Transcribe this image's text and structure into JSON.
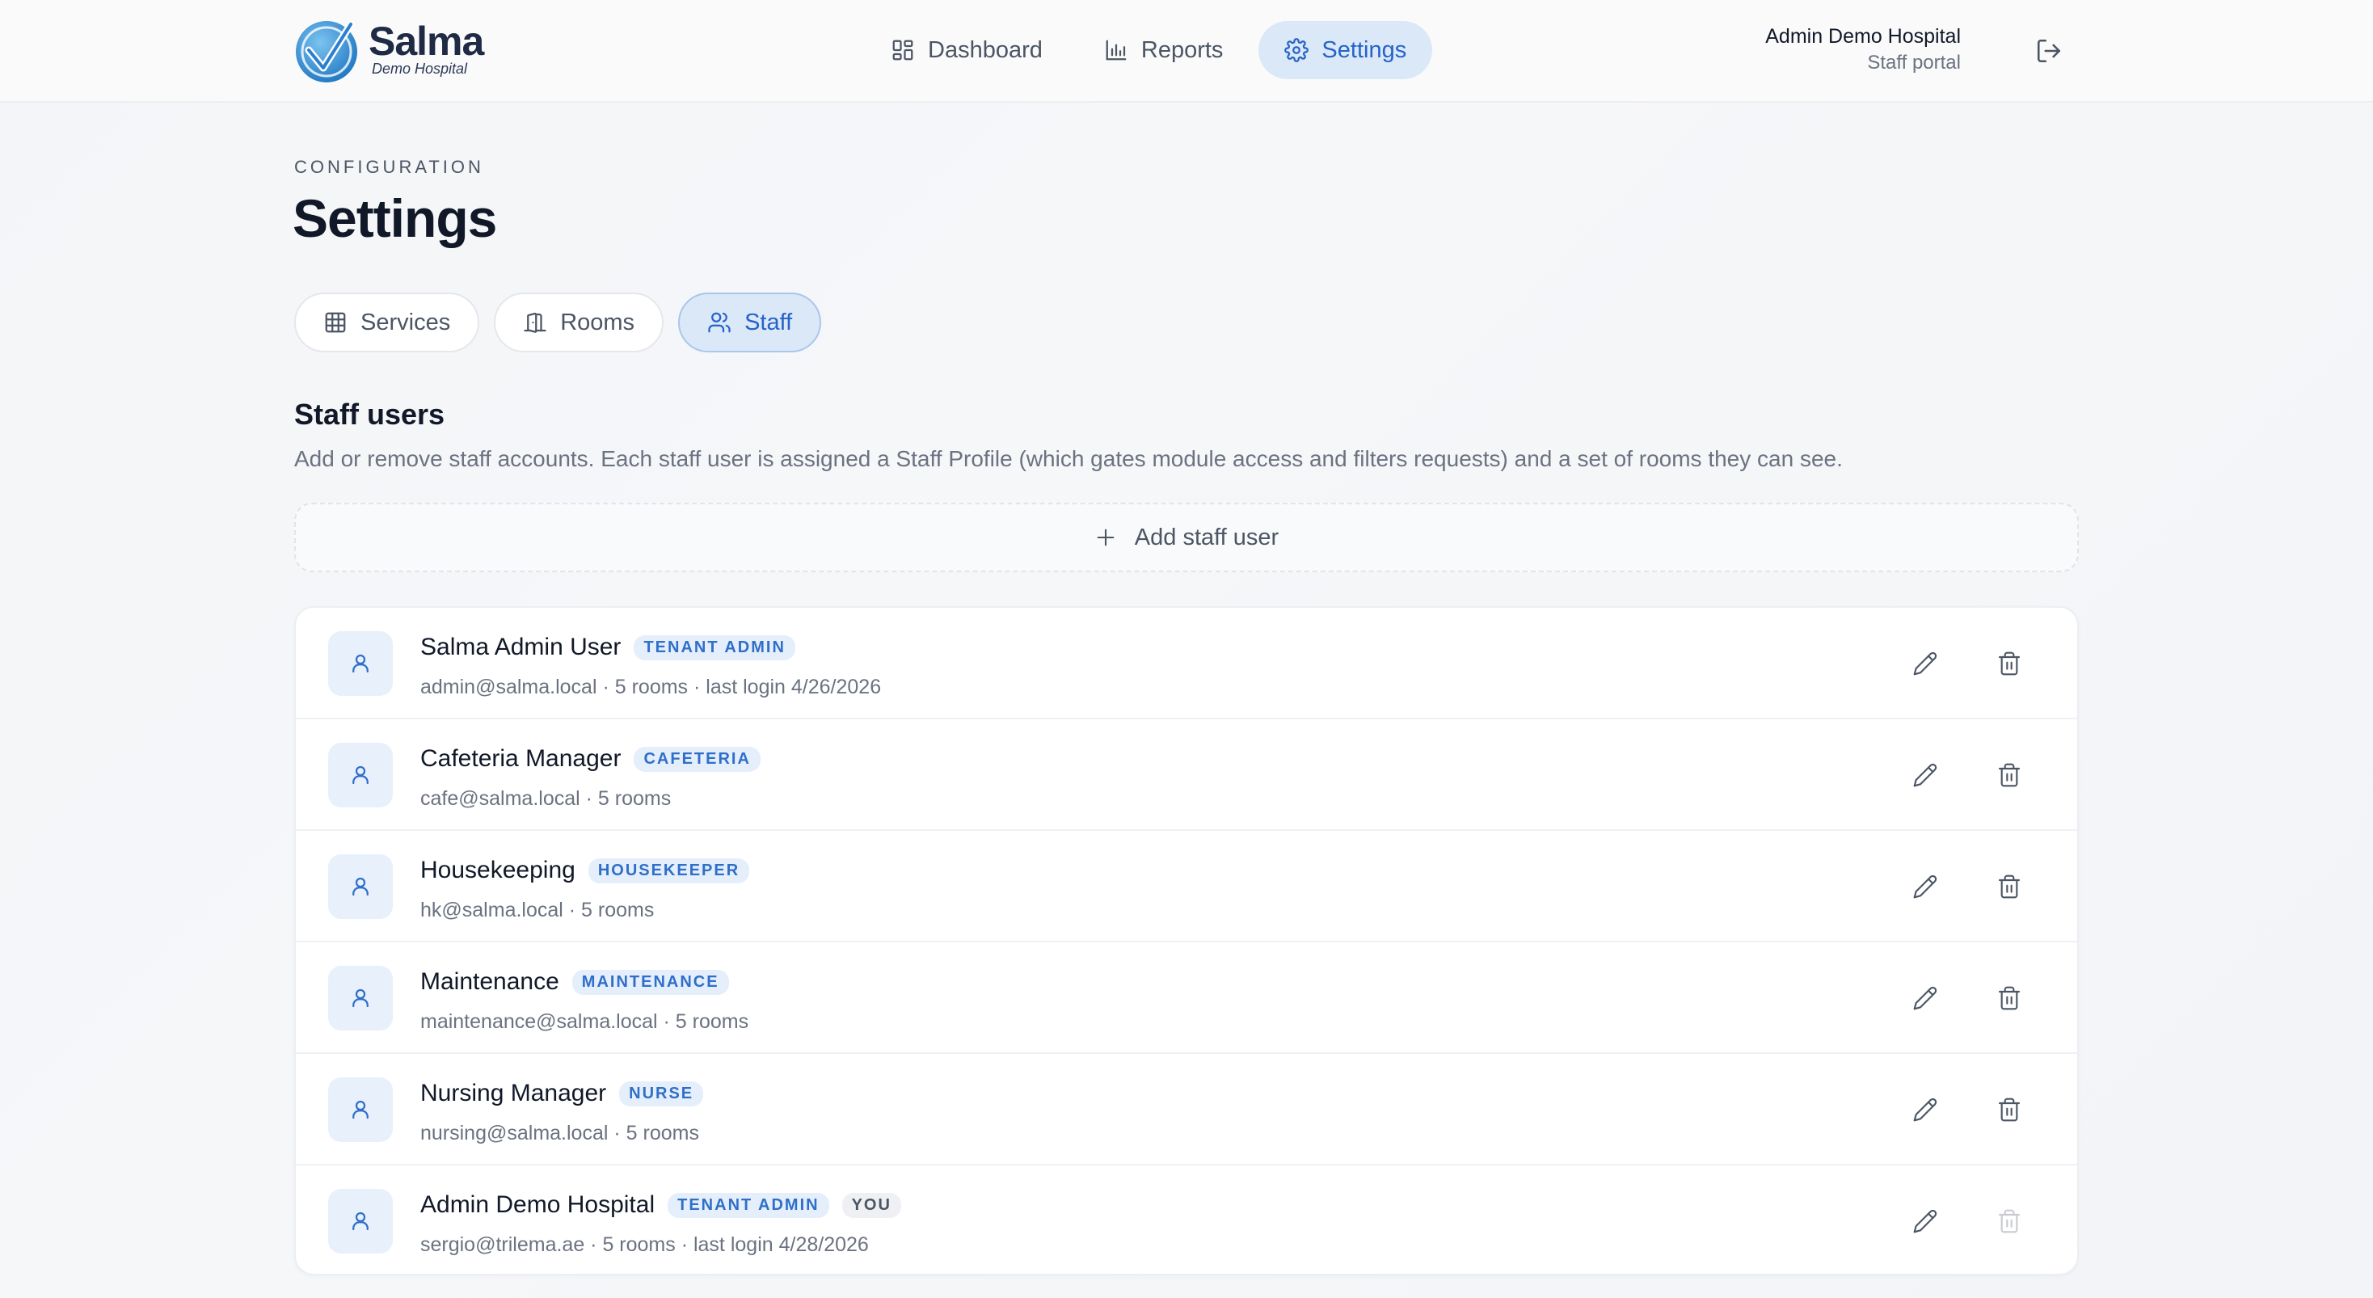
{
  "brand": {
    "name": "Salma",
    "sub": "Demo Hospital"
  },
  "nav": [
    {
      "label": "Dashboard",
      "icon": "dashboard-icon",
      "active": false
    },
    {
      "label": "Reports",
      "icon": "bar-chart-icon",
      "active": false
    },
    {
      "label": "Settings",
      "icon": "gear-icon",
      "active": true
    }
  ],
  "user": {
    "name": "Admin Demo Hospital",
    "role": "Staff portal"
  },
  "page": {
    "eyebrow": "CONFIGURATION",
    "title": "Settings"
  },
  "tabs": [
    {
      "label": "Services",
      "icon": "grid-icon",
      "active": false
    },
    {
      "label": "Rooms",
      "icon": "door-icon",
      "active": false
    },
    {
      "label": "Staff",
      "icon": "users-icon",
      "active": true
    }
  ],
  "section": {
    "title": "Staff users",
    "description": "Add or remove staff accounts. Each staff user is assigned a Staff Profile (which gates module access and filters requests) and a set of rooms they can see."
  },
  "add_button": {
    "label": "Add staff user"
  },
  "staff": [
    {
      "name": "Salma Admin User",
      "badge": "TENANT ADMIN",
      "you": "",
      "meta": "admin@salma.local  ·  5 rooms  ·  last login 4/26/2026",
      "can_delete": true
    },
    {
      "name": "Cafeteria Manager",
      "badge": "CAFETERIA",
      "you": "",
      "meta": "cafe@salma.local  ·  5 rooms",
      "can_delete": true
    },
    {
      "name": "Housekeeping",
      "badge": "HOUSEKEEPER",
      "you": "",
      "meta": "hk@salma.local  ·  5 rooms",
      "can_delete": true
    },
    {
      "name": "Maintenance",
      "badge": "MAINTENANCE",
      "you": "",
      "meta": "maintenance@salma.local  ·  5 rooms",
      "can_delete": true
    },
    {
      "name": "Nursing Manager",
      "badge": "NURSE",
      "you": "",
      "meta": "nursing@salma.local  ·  5 rooms",
      "can_delete": true
    },
    {
      "name": "Admin Demo Hospital",
      "badge": "TENANT ADMIN",
      "you": "YOU",
      "meta": "sergio@trilema.ae  ·  5 rooms  ·  last login 4/28/2026",
      "can_delete": false
    }
  ],
  "colors": {
    "accent": "#2563c8",
    "accent_bg": "#dbe8f7",
    "badge_bg": "#e5eefb"
  }
}
